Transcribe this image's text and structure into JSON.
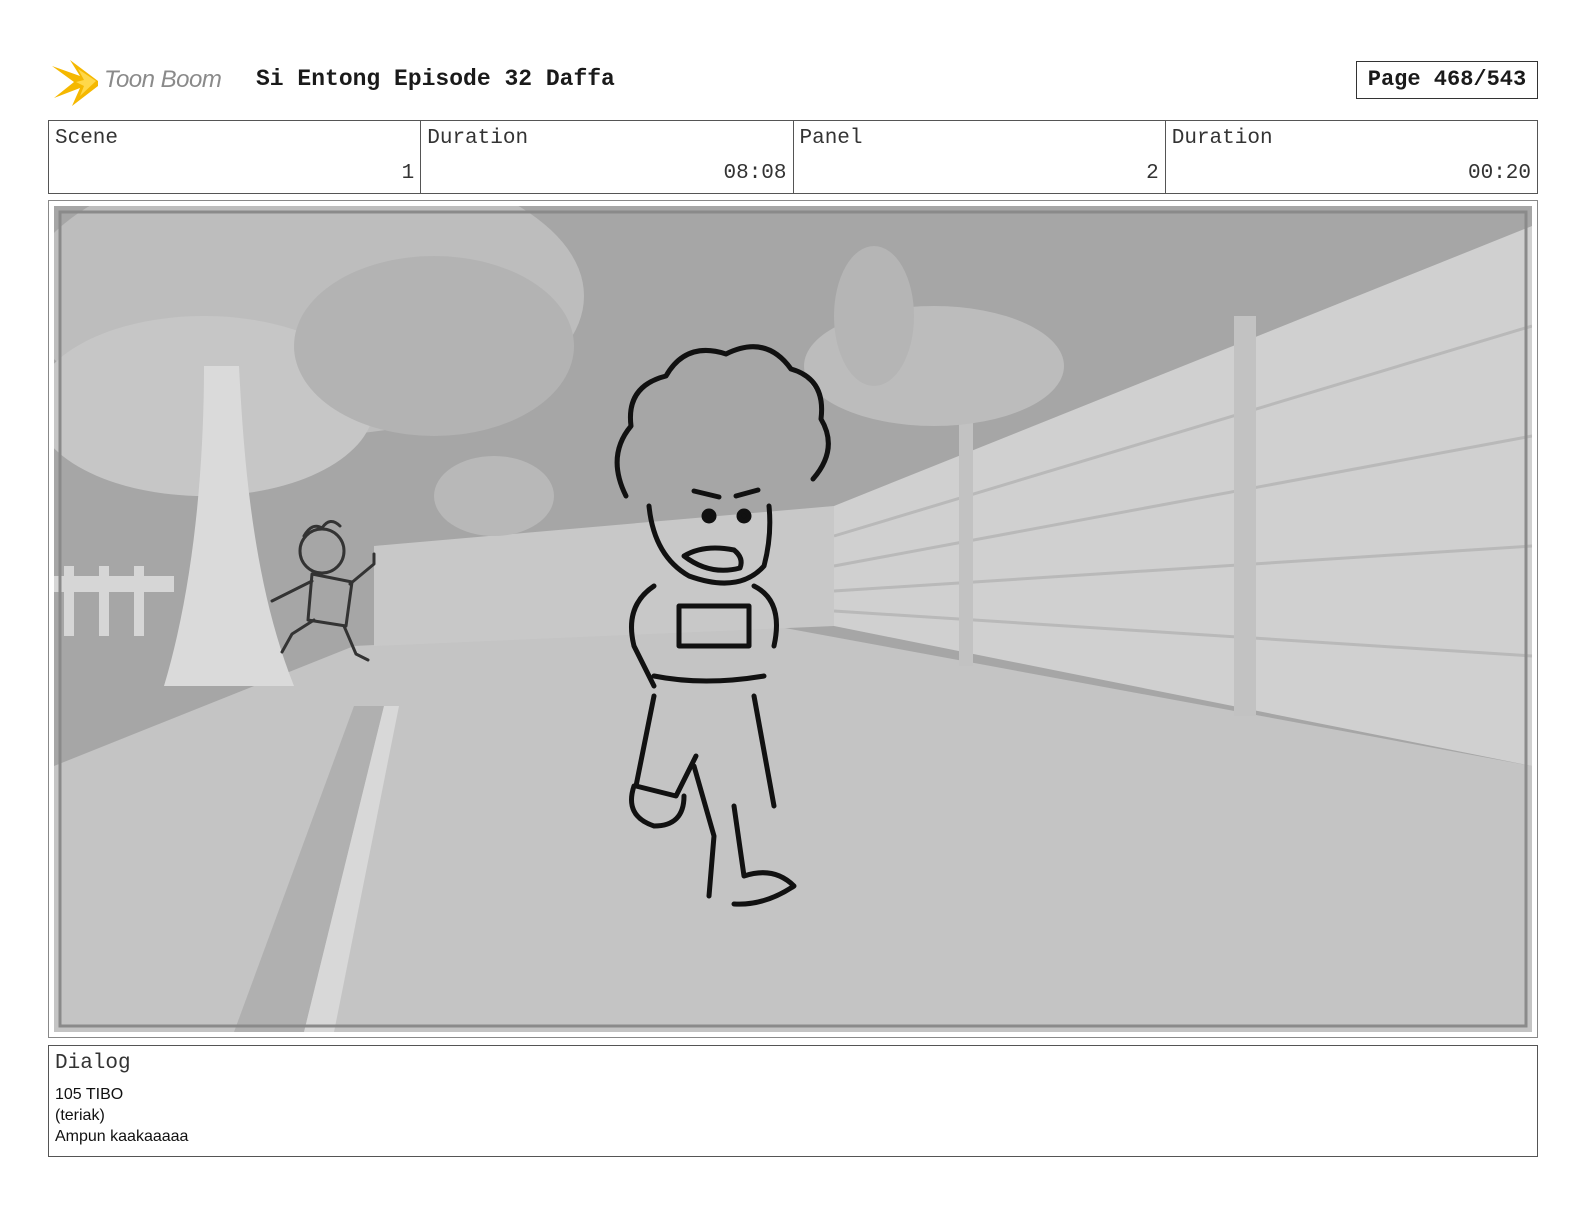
{
  "header": {
    "logo_text": "Toon Boom",
    "title": "Si Entong Episode 32 Daffa",
    "page": "Page 468/543"
  },
  "info": {
    "scene_label": "Scene",
    "scene_value": "1",
    "scene_duration_label": "Duration",
    "scene_duration_value": "08:08",
    "panel_label": "Panel",
    "panel_value": "2",
    "panel_duration_label": "Duration",
    "panel_duration_value": "00:20"
  },
  "dialog": {
    "label": "Dialog",
    "lines": [
      "105 TIBO",
      "(teriak)",
      "Ampun kaakaaaaa"
    ]
  },
  "colors": {
    "logo_star": "#f5b800",
    "logo_text": "#8a8a8a",
    "sky": "#a6a6a6",
    "road": "#c4c4c4",
    "wall": "#d0d0d0"
  }
}
